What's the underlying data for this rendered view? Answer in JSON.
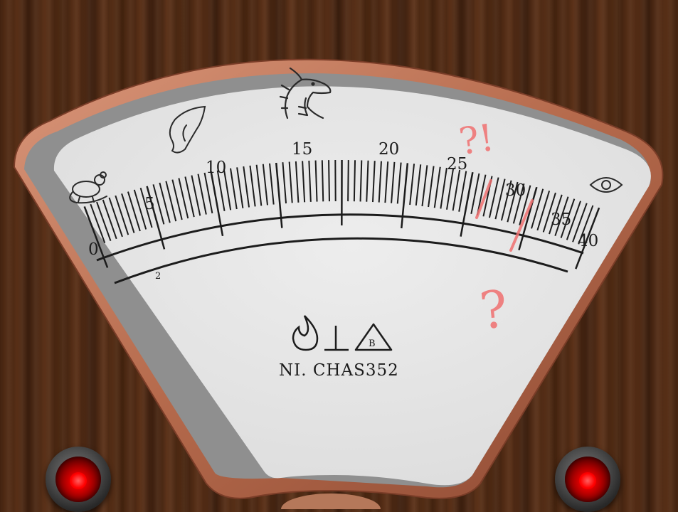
{
  "gauge": {
    "scale_labels": [
      "0",
      "5",
      "10",
      "15",
      "20",
      "25",
      "30",
      "35",
      "40"
    ],
    "scale_min": 0,
    "scale_max": 40,
    "small_mark": "2",
    "model_text": "NI. CHAS352",
    "certification_badge": "B",
    "danger_marks_top": "?!",
    "danger_mark_bottom": "?",
    "icons": [
      "rat-icon",
      "elf-ear-icon",
      "dragon-icon",
      "eye-icon"
    ],
    "symbols": [
      "flame-icon",
      "ground-symbol-icon",
      "certification-triangle-icon"
    ]
  },
  "colors": {
    "dial_face": "#e6e6e6",
    "rim": "#c07a5a",
    "ink": "#1c1c1c",
    "danger": "#f07070",
    "wood": "#4b2812",
    "indicator_light": "#ff0000"
  },
  "buttons": {
    "left": "indicator-light-left",
    "right": "indicator-light-right"
  }
}
